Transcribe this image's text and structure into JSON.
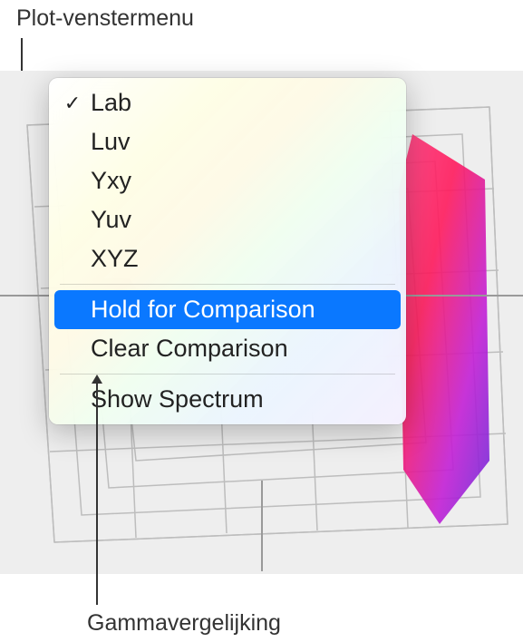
{
  "callouts": {
    "top": "Plot-venstermenu",
    "bottom": "Gammavergelijking"
  },
  "menu": {
    "colorSpaces": [
      {
        "label": "Lab",
        "checked": true
      },
      {
        "label": "Luv",
        "checked": false
      },
      {
        "label": "Yxy",
        "checked": false
      },
      {
        "label": "Yuv",
        "checked": false
      },
      {
        "label": "XYZ",
        "checked": false
      }
    ],
    "comparison": {
      "hold": "Hold for Comparison",
      "clear": "Clear Comparison"
    },
    "spectrum": {
      "show": "Show Spectrum"
    },
    "highlighted": "hold"
  }
}
